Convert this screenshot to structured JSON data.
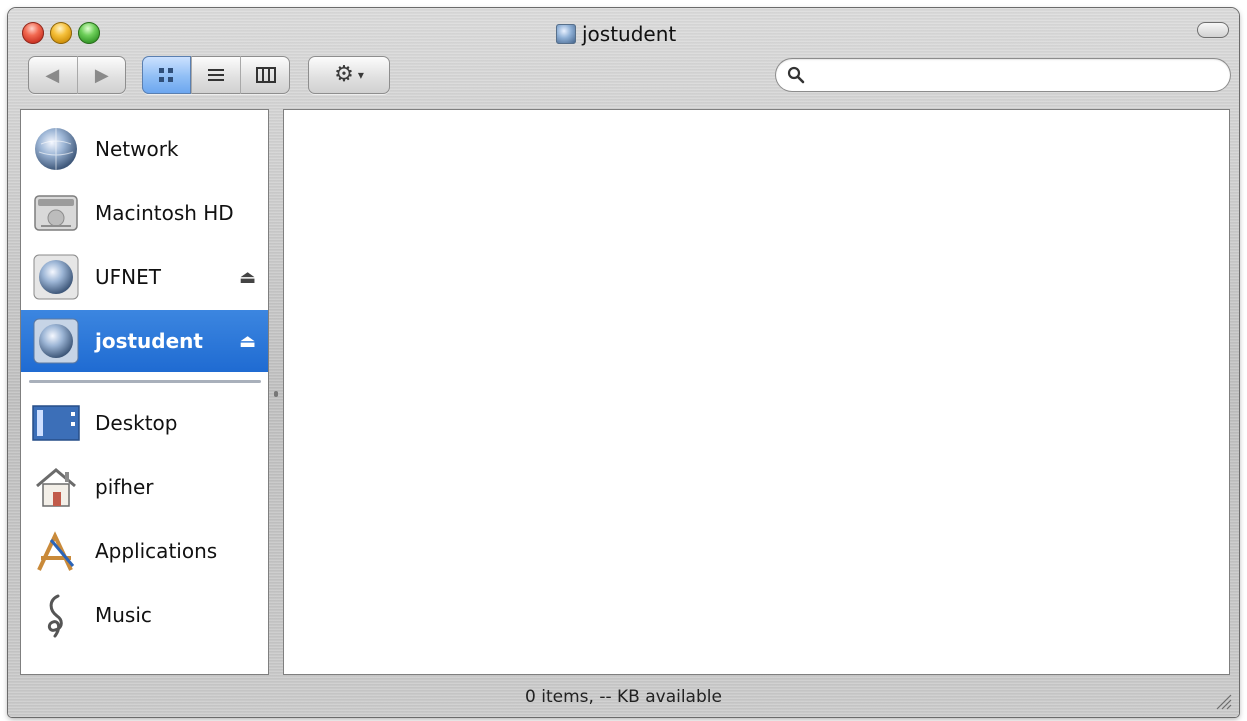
{
  "window": {
    "title": "jostudent",
    "status_text": "0 items, -- KB available"
  },
  "toolbar": {
    "back_label": "◀",
    "forward_label": "▶",
    "view_icon_label": "⊞",
    "view_list_label": "≡",
    "view_columns_label": "▥",
    "action_label": "⚙",
    "action_caret": "▾"
  },
  "search": {
    "placeholder": "",
    "value": ""
  },
  "sidebar": {
    "devices": [
      {
        "label": "Network",
        "icon": "network-globe-icon",
        "eject": false
      },
      {
        "label": "Macintosh HD",
        "icon": "hard-drive-icon",
        "eject": false
      },
      {
        "label": "UFNET",
        "icon": "network-volume-icon",
        "eject": true
      },
      {
        "label": "jostudent",
        "icon": "network-volume-icon",
        "eject": true
      }
    ],
    "places": [
      {
        "label": "Desktop",
        "icon": "desktop-icon"
      },
      {
        "label": "pifher",
        "icon": "home-icon"
      },
      {
        "label": "Applications",
        "icon": "applications-icon"
      },
      {
        "label": "Music",
        "icon": "music-icon"
      }
    ],
    "eject_glyph": "⏏"
  },
  "colors": {
    "selection": "#1f6bd2",
    "window_metal": "#c8c8c8"
  }
}
